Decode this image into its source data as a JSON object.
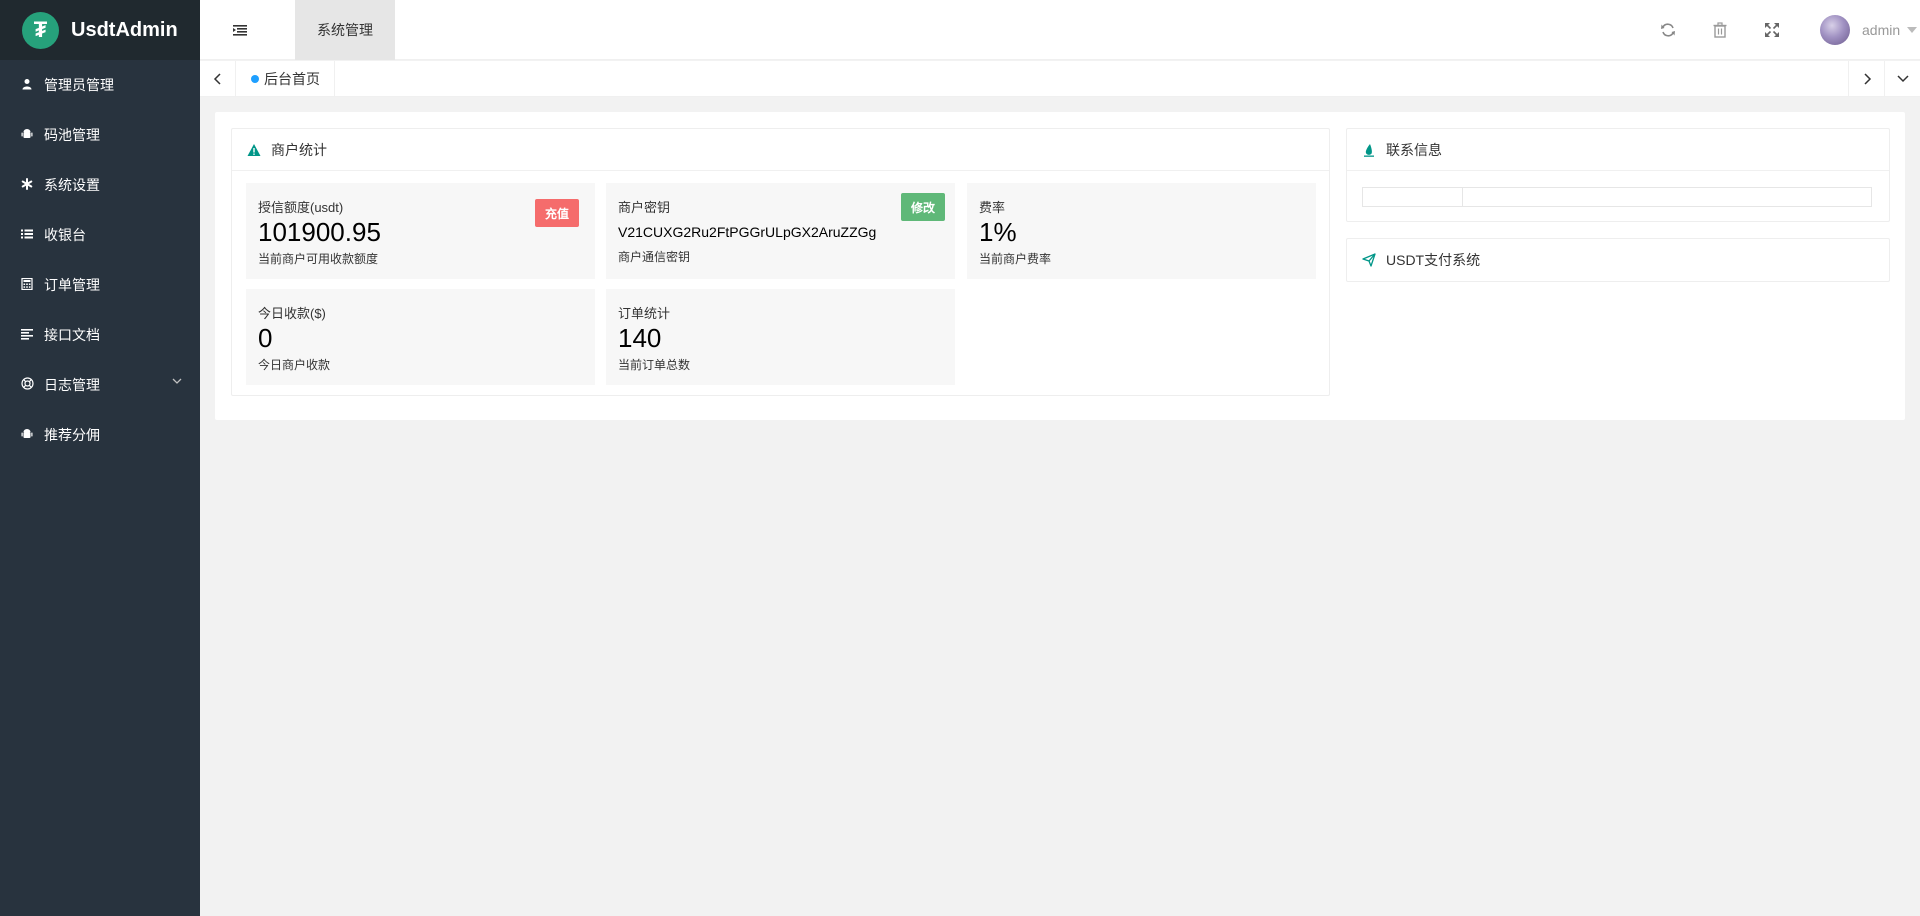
{
  "app": {
    "title": "UsdtAdmin",
    "logo_glyph": "₮",
    "brand_color": "#26a17b"
  },
  "sidebar": {
    "items": [
      {
        "label": "管理员管理",
        "icon": "user-icon"
      },
      {
        "label": "码池管理",
        "icon": "android-icon"
      },
      {
        "label": "系统设置",
        "icon": "asterisk-icon"
      },
      {
        "label": "收银台",
        "icon": "list-icon"
      },
      {
        "label": "订单管理",
        "icon": "calculator-icon"
      },
      {
        "label": "接口文档",
        "icon": "align-left-icon"
      },
      {
        "label": "日志管理",
        "icon": "life-ring-icon",
        "has_submenu": true
      },
      {
        "label": "推荐分佣",
        "icon": "android-icon"
      }
    ]
  },
  "header": {
    "top_tab": "系统管理",
    "user_name": "admin",
    "icons": [
      "refresh-icon",
      "trash-icon",
      "fullscreen-icon"
    ]
  },
  "tabbar": {
    "tabs": [
      {
        "label": "后台首页",
        "active": true
      }
    ]
  },
  "merchant_stats": {
    "title": "商户统计",
    "cards": [
      {
        "title": "授信额度(usdt)",
        "value": "101900.95",
        "desc": "当前商户可用收款额度",
        "button": "充值",
        "button_color": "#f56c6c"
      },
      {
        "title": "商户密钥",
        "value": "V21CUXG2Ru2FtPGGrULpGX2AruZZGg",
        "desc": "商户通信密钥",
        "button": "修改",
        "button_color": "#5fb878"
      },
      {
        "title": "费率",
        "value": "1%",
        "desc": "当前商户费率"
      },
      {
        "title": "今日收款($)",
        "value": "0",
        "desc": "今日商户收款"
      },
      {
        "title": "订单统计",
        "value": "140",
        "desc": "当前订单总数"
      }
    ]
  },
  "contact": {
    "title": "联系信息"
  },
  "system": {
    "title": "USDT支付系统"
  },
  "colors": {
    "sidebar_bg": "#28333e",
    "accent_blue": "#1e9fff",
    "teal": "#009688"
  }
}
